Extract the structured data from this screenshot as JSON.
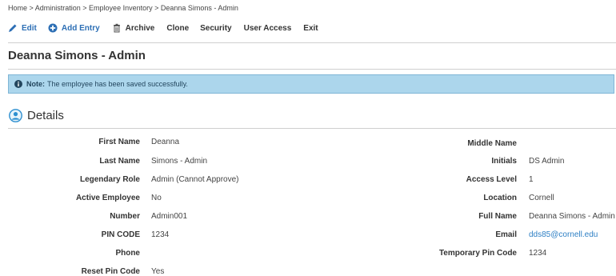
{
  "breadcrumb": "Home > Administration > Employee Inventory > Deanna Simons - Admin",
  "toolbar": {
    "edit": "Edit",
    "add_entry": "Add Entry",
    "archive": "Archive",
    "clone": "Clone",
    "security": "Security",
    "user_access": "User Access",
    "exit": "Exit"
  },
  "page_title": "Deanna Simons - Admin",
  "alert": {
    "label": "Note:",
    "message": "The employee has been saved successfully."
  },
  "section_title": "Details",
  "left_fields": [
    {
      "label": "First Name",
      "value": "Deanna"
    },
    {
      "label": "Last Name",
      "value": "Simons - Admin"
    },
    {
      "label": "Legendary Role",
      "value": "Admin (Cannot Approve)"
    },
    {
      "label": "Active Employee",
      "value": "No"
    },
    {
      "label": "Number",
      "value": "Admin001"
    },
    {
      "label": "PIN CODE",
      "value": "1234"
    },
    {
      "label": "Phone",
      "value": ""
    },
    {
      "label": "Reset Pin Code",
      "value": "Yes"
    }
  ],
  "right_fields": [
    {
      "label": "Middle Name",
      "value": ""
    },
    {
      "label": "Initials",
      "value": "DS Admin"
    },
    {
      "label": "Access Level",
      "value": "1"
    },
    {
      "label": "Location",
      "value": "Cornell"
    },
    {
      "label": "Full Name",
      "value": "Deanna Simons - Admin"
    },
    {
      "label": "Email",
      "value": "dds85@cornell.edu"
    },
    {
      "label": "Temporary Pin Code",
      "value": "1234"
    }
  ],
  "colors": {
    "accent": "#2d6fb5",
    "alert_bg": "#acd6ec",
    "link": "#2d7fc4"
  }
}
